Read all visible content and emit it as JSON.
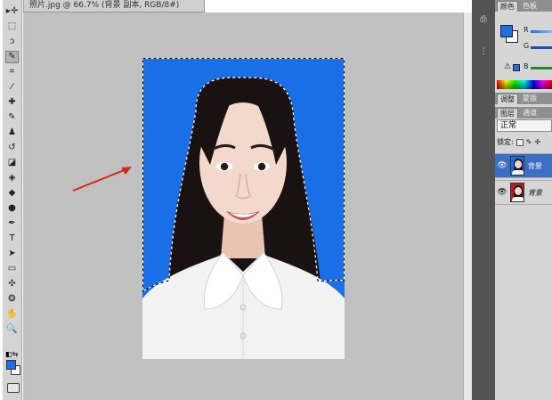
{
  "document": {
    "tab_title": "照片.jpg @ 66.7% (背景 副本, RGB/8#)"
  },
  "tools": [
    {
      "name": "move-tool",
      "glyph": "▸✛"
    },
    {
      "name": "marquee-tool",
      "glyph": "⬚"
    },
    {
      "name": "lasso-tool",
      "glyph": "ↄ"
    },
    {
      "name": "quick-selection-tool",
      "glyph": "✎"
    },
    {
      "name": "crop-tool",
      "glyph": "⌗"
    },
    {
      "name": "eyedropper-tool",
      "glyph": "⁄"
    },
    {
      "name": "healing-brush-tool",
      "glyph": "✚"
    },
    {
      "name": "brush-tool",
      "glyph": "✎"
    },
    {
      "name": "clone-stamp-tool",
      "glyph": "♟"
    },
    {
      "name": "history-brush-tool",
      "glyph": "↺"
    },
    {
      "name": "eraser-tool",
      "glyph": "◪"
    },
    {
      "name": "paint-bucket-tool",
      "glyph": "◈"
    },
    {
      "name": "blur-tool",
      "glyph": "◆"
    },
    {
      "name": "dodge-tool",
      "glyph": "●"
    },
    {
      "name": "pen-tool",
      "glyph": "✒"
    },
    {
      "name": "type-tool",
      "glyph": "T"
    },
    {
      "name": "path-selection-tool",
      "glyph": "➤"
    },
    {
      "name": "rectangle-tool",
      "glyph": "▭"
    },
    {
      "name": "3d-rotate-tool",
      "glyph": "✣"
    },
    {
      "name": "3d-orbit-tool",
      "glyph": "❂"
    },
    {
      "name": "hand-tool",
      "glyph": "✋"
    },
    {
      "name": "zoom-tool",
      "glyph": "🔍"
    }
  ],
  "swatches": {
    "foreground": "#1a6fe6",
    "background": "#ffffff"
  },
  "panels": {
    "color_tabs": [
      "颜色",
      "色板"
    ],
    "color": {
      "r_label": "R",
      "g_label": "G",
      "b_label": "B"
    },
    "adjust_tabs": [
      "调整",
      "蒙版"
    ],
    "layer_tabs": [
      "图层",
      "通道"
    ],
    "blend_mode": "正常",
    "lock_label": "锁定:",
    "layers": [
      {
        "name": "背景",
        "selected": true,
        "italic": false
      },
      {
        "name": "背景",
        "selected": false,
        "italic": true
      }
    ]
  },
  "colors": {
    "photo_background": "#1a6fe6",
    "canvas_gray": "#c0c0c0",
    "arrow": "#d9261c",
    "layer_selected": "#3c6ec4"
  }
}
